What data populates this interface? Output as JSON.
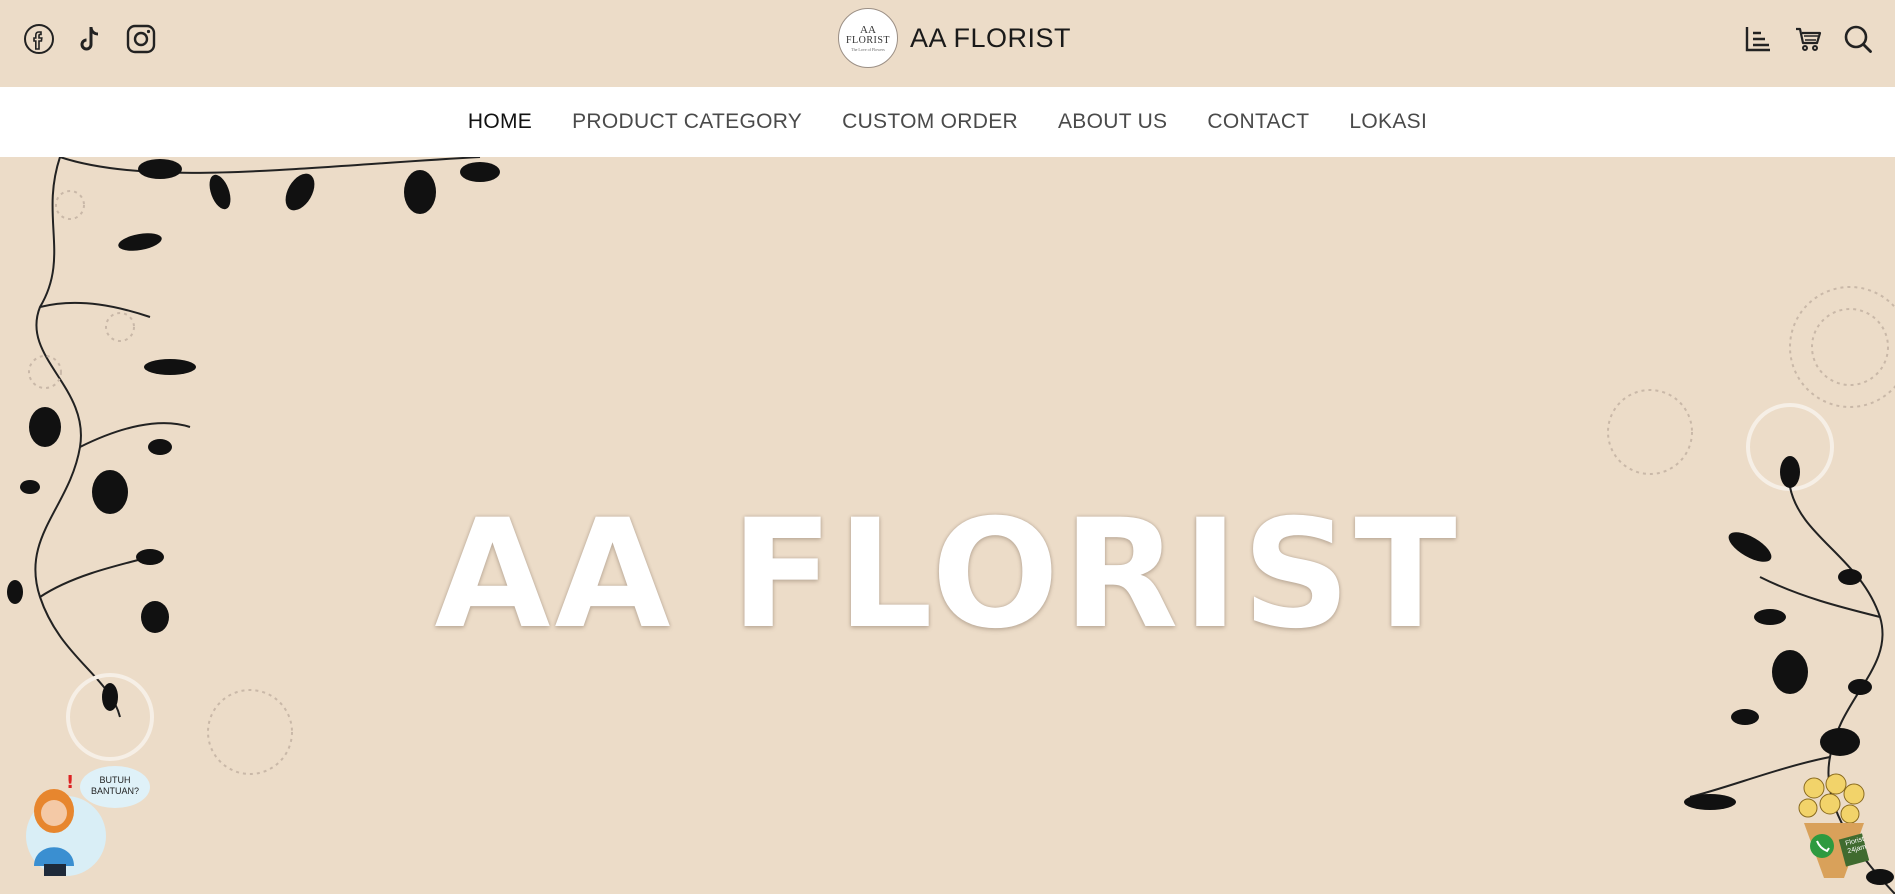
{
  "brand": {
    "name": "AA FLORIST",
    "logo_line1": "AA",
    "logo_line2": "FLORIST",
    "logo_tagline": "The Love of Flowers"
  },
  "nav": {
    "items": [
      {
        "label": "HOME",
        "active": true
      },
      {
        "label": "PRODUCT CATEGORY",
        "active": false
      },
      {
        "label": "CUSTOM ORDER",
        "active": false
      },
      {
        "label": "ABOUT US",
        "active": false
      },
      {
        "label": "CONTACT",
        "active": false
      },
      {
        "label": "LOKASI",
        "active": false
      }
    ]
  },
  "hero": {
    "title": "AA FLORIST"
  },
  "help_widget": {
    "text": "BUTUH BANTUAN?"
  },
  "wa_widget": {
    "tag_text": "Florist 24jam"
  },
  "icons": {
    "left": [
      "facebook-icon",
      "tiktok-icon",
      "instagram-icon"
    ],
    "right": [
      "sort-icon",
      "cart-icon",
      "search-icon"
    ]
  },
  "colors": {
    "background": "#ecdcc8",
    "nav_bg": "#ffffff",
    "text": "#222222",
    "nav_text": "#4a4a4a"
  }
}
